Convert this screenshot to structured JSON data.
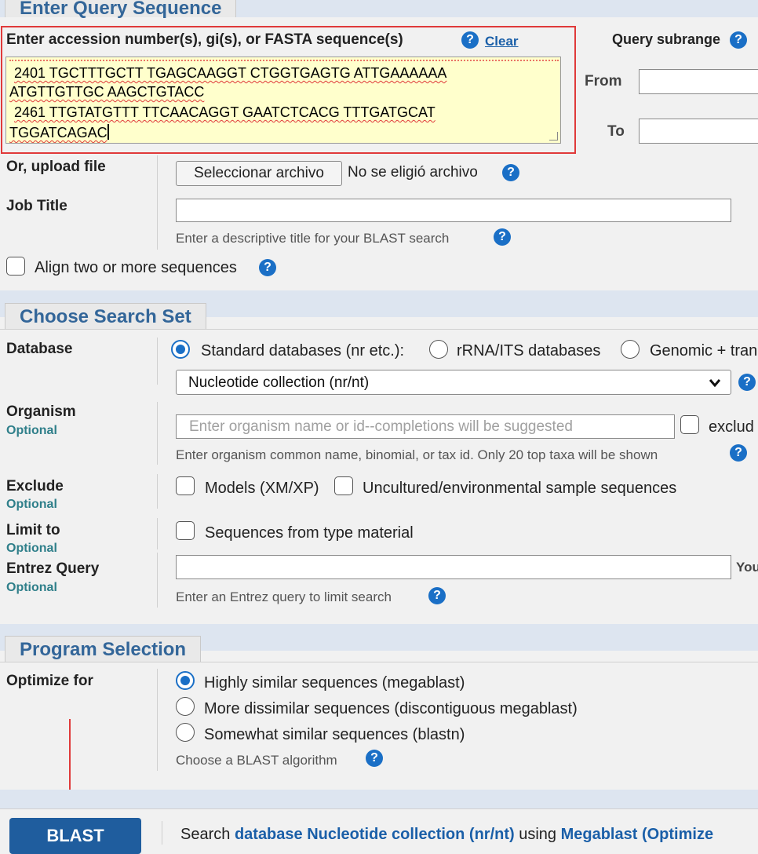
{
  "query_section": {
    "title": "Enter Query Sequence",
    "label": "Enter accession number(s), gi(s), or FASTA sequence(s)",
    "clear": "Clear",
    "sequence_lines": [
      "2401 TGCTTTGCTT TGAGCAAGGT CTGGTGAGTG ATTGAAAAAA",
      "ATGTTGTTGC AAGCTGTACC",
      "2461 TTGTATGTTT TTCAACAGGT GAATCTCACG TTTGATGCAT",
      "TGGATCAGAC"
    ],
    "subrange_label": "Query subrange",
    "from_label": "From",
    "to_label": "To",
    "upload_label": "Or, upload file",
    "file_button": "Seleccionar archivo",
    "file_status": "No se eligió archivo",
    "job_title_label": "Job Title",
    "job_title_hint": "Enter a descriptive title for your BLAST search",
    "align_two": "Align two or more sequences"
  },
  "search_set": {
    "title": "Choose Search Set",
    "database_label": "Database",
    "radio_standard": "Standard databases (nr etc.):",
    "radio_rrna": "rRNA/ITS databases",
    "radio_genomic": "Genomic + tran",
    "db_select": "Nucleotide collection (nr/nt)",
    "organism_label": "Organism",
    "optional": "Optional",
    "organism_placeholder": "Enter organism name or id--completions will be suggested",
    "exclude_partial": "exclud",
    "organism_hint": "Enter organism common name, binomial, or tax id. Only 20 top taxa will be shown",
    "exclude_label": "Exclude",
    "models": "Models (XM/XP)",
    "uncultured": "Uncultured/environmental sample sequences",
    "limit_label": "Limit to",
    "type_material": "Sequences from type material",
    "entrez_label": "Entrez Query",
    "entrez_trailing": "You",
    "entrez_hint": "Enter an Entrez query to limit search"
  },
  "program": {
    "title": "Program Selection",
    "optimize_label": "Optimize for",
    "options": [
      "Highly similar sequences (megablast)",
      "More dissimilar sequences (discontiguous megablast)",
      "Somewhat similar sequences (blastn)"
    ],
    "hint": "Choose a BLAST algorithm"
  },
  "footer": {
    "blast_button": "BLAST",
    "search_text": "Search",
    "search_db": "database Nucleotide collection (nr/nt)",
    "search_using": "using",
    "search_algo": "Megablast (Optimize"
  },
  "icons": {
    "help": "help-icon",
    "chevron": "chevron-down-icon"
  },
  "colors": {
    "accent": "#1a6fc6",
    "section_title": "#336699",
    "highlight_box": "#e03a3a",
    "textarea_bg": "#ffffcc"
  }
}
